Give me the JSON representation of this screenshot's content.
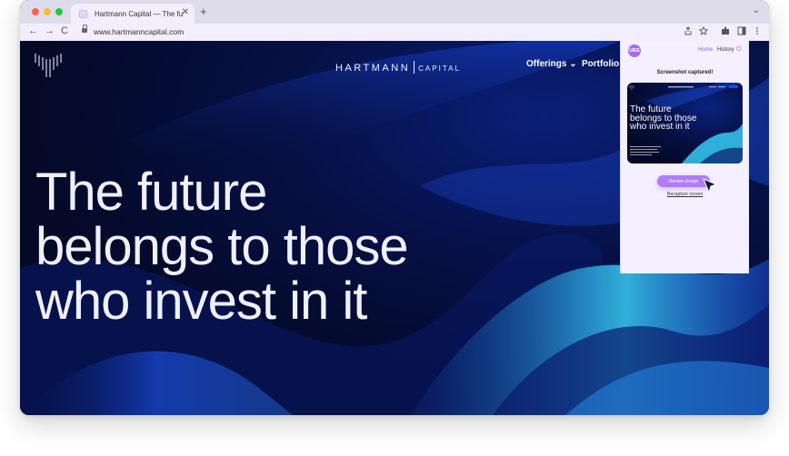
{
  "browser": {
    "tab_title": "Hartmann Capital — The futur",
    "tab_close": "✕",
    "new_tab": "+",
    "url": "www.hartmanncapital.com",
    "nav": {
      "back": "←",
      "forward": "→",
      "reload": "C"
    },
    "chevron": "⌄",
    "toolbar_icons": [
      "share-icon",
      "star-icon",
      "extensions-icon",
      "sidepanel-icon",
      "menu-icon"
    ]
  },
  "site": {
    "brand_name": "HARTMANN",
    "brand_suffix": "CAPITAL",
    "menu": {
      "offerings": "Offerings",
      "offerings_caret": "⌄",
      "portfolio": "Portfolio"
    },
    "hero_lines": [
      "The future",
      "belongs to those",
      "who invest in it"
    ],
    "colors": {
      "background": "#040926",
      "accent_blue": "#1f5bff",
      "accent_cyan": "#39d7ff",
      "text": "#eef0ff"
    }
  },
  "extension": {
    "logo_text": "UIEE",
    "nav": {
      "home": "Home",
      "history": "History"
    },
    "status": "Screenshot captured!",
    "thumbnail_hero": [
      "The future",
      "belongs to those",
      "who invest in it"
    ],
    "review_button": "Review design",
    "recapture_link": "Recapture screen",
    "colors": {
      "accent": "#b07cf7",
      "background": "#f4f0ff"
    }
  }
}
